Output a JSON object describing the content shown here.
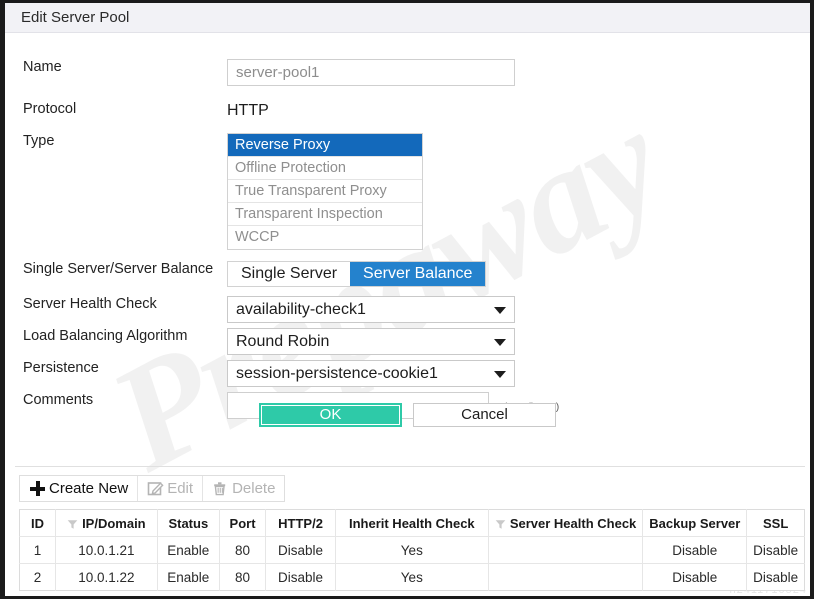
{
  "window": {
    "title": "Edit Server Pool"
  },
  "watermark": {
    "big_text": "Prepaway",
    "corner_text": "n2411710524"
  },
  "form": {
    "name": {
      "label": "Name",
      "value": "server-pool1",
      "placeholder": "server-pool1"
    },
    "protocol": {
      "label": "Protocol",
      "value": "HTTP"
    },
    "type": {
      "label": "Type",
      "options": [
        "Reverse Proxy",
        "Offline Protection",
        "True Transparent Proxy",
        "Transparent Inspection",
        "WCCP"
      ],
      "selected": "Reverse Proxy"
    },
    "balance_mode": {
      "label": "Single Server/Server Balance",
      "options": [
        "Single Server",
        "Server Balance"
      ],
      "selected": "Server Balance"
    },
    "server_health_check": {
      "label": "Server Health Check",
      "value": "availability-check1"
    },
    "load_balancing_algorithm": {
      "label": "Load Balancing Algorithm",
      "value": "Round Robin"
    },
    "persistence": {
      "label": "Persistence",
      "value": "session-persistence-cookie1"
    },
    "comments": {
      "label": "Comments",
      "value": "",
      "counter": "0/199 (bytes)"
    }
  },
  "buttons": {
    "ok": "OK",
    "cancel": "Cancel",
    "ok_color": "#2ecaa8"
  },
  "toolbar": {
    "create_new": "Create New",
    "edit": "Edit",
    "delete": "Delete"
  },
  "table": {
    "columns": [
      {
        "label": "ID",
        "filter": false
      },
      {
        "label": "IP/Domain",
        "filter": true
      },
      {
        "label": "Status",
        "filter": false
      },
      {
        "label": "Port",
        "filter": false
      },
      {
        "label": "HTTP/2",
        "filter": false
      },
      {
        "label": "Inherit Health Check",
        "filter": false
      },
      {
        "label": "Server Health Check",
        "filter": true
      },
      {
        "label": "Backup Server",
        "filter": false
      },
      {
        "label": "SSL",
        "filter": false
      }
    ],
    "rows": [
      {
        "id": "1",
        "ip_domain": "10.0.1.21",
        "status": "Enable",
        "port": "80",
        "http2": "Disable",
        "inherit_health_check": "Yes",
        "server_health_check": "",
        "backup_server": "Disable",
        "ssl": "Disable"
      },
      {
        "id": "2",
        "ip_domain": "10.0.1.22",
        "status": "Enable",
        "port": "80",
        "http2": "Disable",
        "inherit_health_check": "Yes",
        "server_health_check": "",
        "backup_server": "Disable",
        "ssl": "Disable"
      }
    ]
  }
}
